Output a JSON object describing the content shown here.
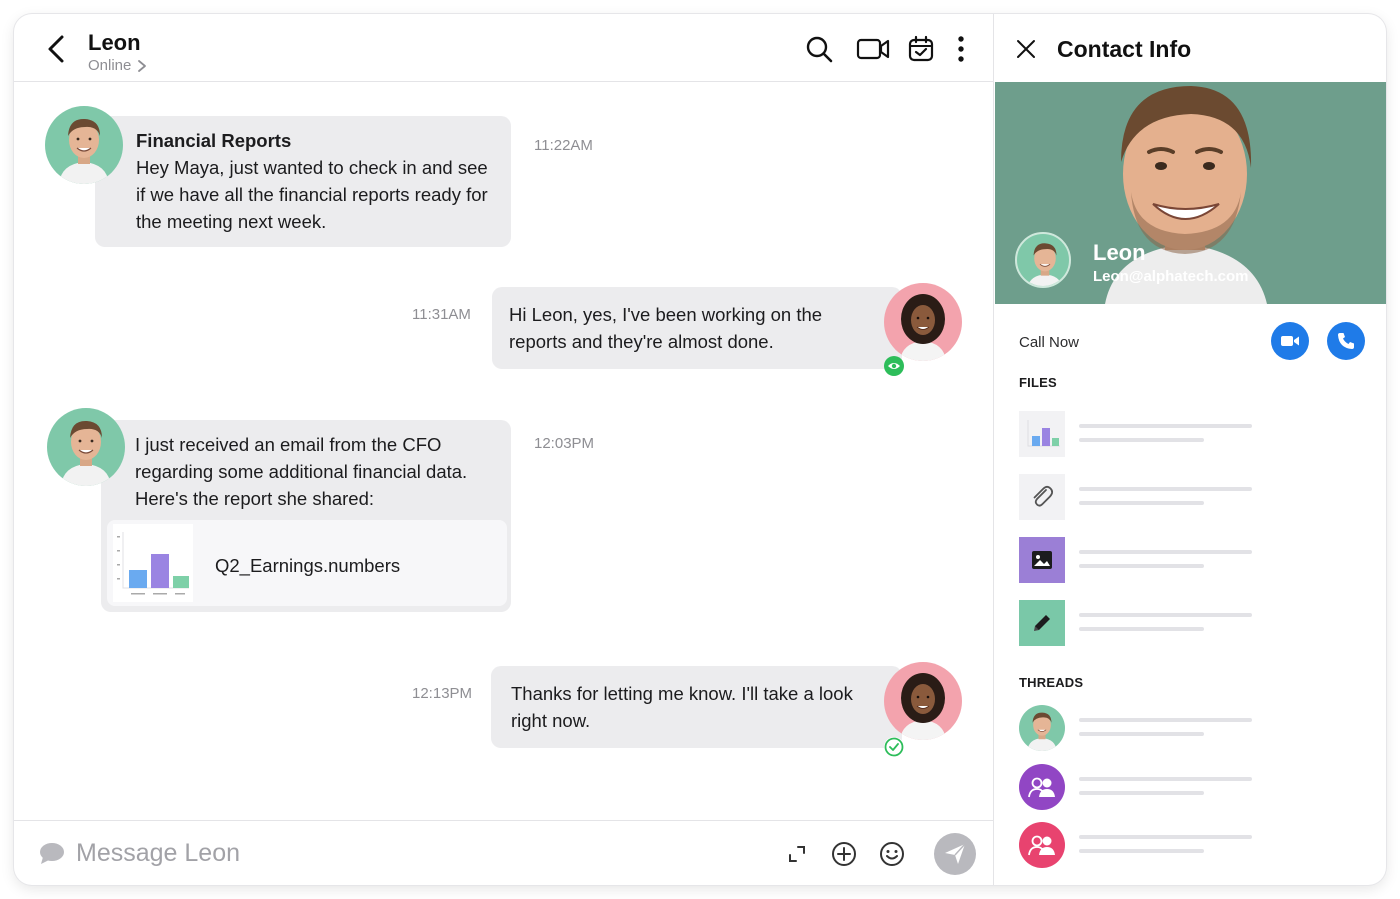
{
  "header": {
    "name": "Leon",
    "status": "Online"
  },
  "messages": [
    {
      "title": "Financial Reports",
      "lines": [
        "Hey Maya, just wanted to check in and see",
        "if we have all the financial reports ready for",
        "the meeting next week."
      ],
      "time": "11:22AM"
    },
    {
      "lines": [
        "Hi Leon, yes, I've been working on the",
        "reports and they're almost done."
      ],
      "time": "11:31AM"
    },
    {
      "lines": [
        "I just received an email from the CFO",
        "regarding some additional financial data.",
        "Here's the report she shared:"
      ],
      "time": "12:03PM",
      "attachment": "Q2_Earnings.numbers"
    },
    {
      "lines": [
        "Thanks for letting me know. I'll take a look",
        "right now."
      ],
      "time": "12:13PM"
    }
  ],
  "composer": {
    "placeholder": "Message Leon"
  },
  "info": {
    "title": "Contact Info",
    "name": "Leon",
    "email": "Leon@alphatech.com",
    "call_label": "Call Now",
    "files_label": "FILES",
    "threads_label": "THREADS"
  },
  "colors": {
    "accent_blue": "#1f7be8",
    "read_green": "#2dbd5a",
    "bubble_gray": "#ececee",
    "image_file_purple": "#9b7fd6",
    "edit_file_green": "#7ac8a8",
    "thread_purple": "#9146c4",
    "thread_pink": "#e8436f"
  },
  "icons": [
    "back-chevron-icon",
    "chevron-right-icon",
    "search-icon",
    "video-icon",
    "calendar-check-icon",
    "more-vertical-icon",
    "eye-icon",
    "check-circle-icon",
    "speech-bubble-icon",
    "expand-icon",
    "plus-circle-icon",
    "smiley-icon",
    "send-icon",
    "close-icon",
    "video-call-icon",
    "phone-icon",
    "chart-icon",
    "paperclip-icon",
    "image-icon",
    "pencil-icon",
    "group-icon"
  ]
}
